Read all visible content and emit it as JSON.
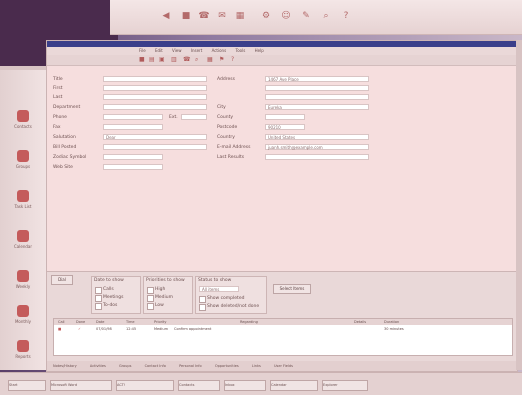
{
  "window": {
    "menu": [
      "File",
      "Edit",
      "View",
      "Insert",
      "Actions",
      "Tools",
      "Help"
    ]
  },
  "form": {
    "left": [
      {
        "label": "Title",
        "value": ""
      },
      {
        "label": "First",
        "value": ""
      },
      {
        "label": "Last",
        "value": ""
      },
      {
        "label": "Department",
        "value": ""
      },
      {
        "label": "Phone",
        "value": ""
      },
      {
        "label": "Fax",
        "value": ""
      },
      {
        "label": "Salutation",
        "value": "Dear"
      },
      {
        "label": "Bill Posted",
        "value": ""
      },
      {
        "label": "Zodiac Symbol",
        "value": ""
      },
      {
        "label": "Web Site",
        "value": ""
      }
    ],
    "ext_label": "Ext.",
    "right": [
      {
        "label": "Address",
        "value": "1467 Ave Place"
      },
      {
        "label": "City",
        "value": "Eureka"
      },
      {
        "label": "County",
        "value": ""
      },
      {
        "label": "Postcode",
        "value": "90210"
      },
      {
        "label": "Country",
        "value": "United States"
      },
      {
        "label": "E-mail Address",
        "value": "juanh.smith@example.com"
      },
      {
        "label": "Last Results",
        "value": ""
      }
    ]
  },
  "lower": {
    "tab_label": "Dial",
    "groups": [
      {
        "title": "Date to show",
        "items": [
          "Calls",
          "Meetings",
          "To-dos"
        ]
      },
      {
        "title": "Priorities to show",
        "items": [
          "High",
          "Medium",
          "Low"
        ]
      },
      {
        "title": "Status to show",
        "items": [
          "All items",
          "Show completed",
          "Show deleted/not done"
        ]
      }
    ],
    "btn_label": "Select Items",
    "grid_headers": [
      "Call",
      "Done",
      "Date",
      "Time",
      "Priority",
      "Regarding",
      "Details",
      "Duration"
    ],
    "grid_row": {
      "date": "07/01/98",
      "time": "12:45",
      "priority": "Medium",
      "regarding": "Confirm appointment",
      "duration": "30 minutes"
    }
  },
  "tabs": [
    "Notes/History",
    "Activities",
    "Groups",
    "Contact Info",
    "Personal Info",
    "Opportunities",
    "Links",
    "User Fields"
  ],
  "sidebar": [
    "Contacts",
    "Groups",
    "Task List",
    "Calendar",
    "Weekly",
    "Monthly",
    "Reports"
  ],
  "taskbar": [
    "Start",
    "Microsoft Word",
    "ACT!",
    "Contacts",
    "Inbox",
    "Calendar",
    "Explorer"
  ],
  "colors": {
    "accent": "#c45b5b",
    "titlebar": "#3b3f8a",
    "desktop": "#4a2b4d"
  }
}
